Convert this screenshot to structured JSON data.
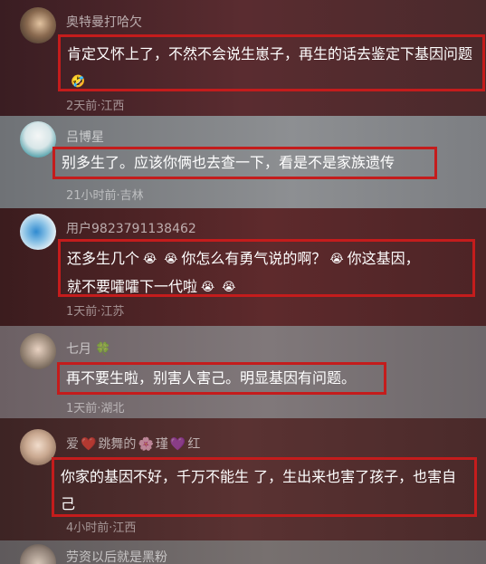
{
  "comments": [
    {
      "username": "奥特曼打哈欠",
      "text": "肯定又怀上了，不然不会说生崽子，再生的话去鉴定下基因问题",
      "emoji": "🤣",
      "meta": "2天前·江西",
      "avatar_color": "#8a6a50"
    },
    {
      "username": "吕博星",
      "text": "别多生了。应该你俩也去查一下，看是不是家族遗传",
      "meta": "21小时前·吉林",
      "avatar_color": "#d8e6e8"
    },
    {
      "username": "用户9823791138462",
      "line1_a": "还多生几个",
      "line1_b": "你怎么有勇气说的啊？",
      "line1_c": "你这基因，",
      "line2": "就不要嚯嚯下一代啦",
      "emoji": "😭",
      "meta": "1天前·江苏",
      "avatar_color": "#a9cfe0"
    },
    {
      "username": "七月",
      "user_icon": "🍀",
      "text": "再不要生啦，别害人害己。明显基因有问题。",
      "meta": "1天前·湖北",
      "avatar_color": "#9c8a7a"
    },
    {
      "username_a": "爱",
      "username_b": "跳舞的",
      "username_c": "瑾",
      "username_d": "红",
      "icon_heart_red": "❤️",
      "icon_flower": "🌸",
      "icon_heart_purple": "💜",
      "text": "你家的基因不好，千万不能生 了，生出来也害了孩子，也害自己",
      "meta": "4小时前·江西",
      "avatar_color": "#c9a890"
    },
    {
      "username": "劳资以后就是黑粉",
      "avatar_color": "#8d7e74"
    }
  ],
  "colors": {
    "highlight_border": "#c41c1c",
    "text": "#ffffff"
  }
}
